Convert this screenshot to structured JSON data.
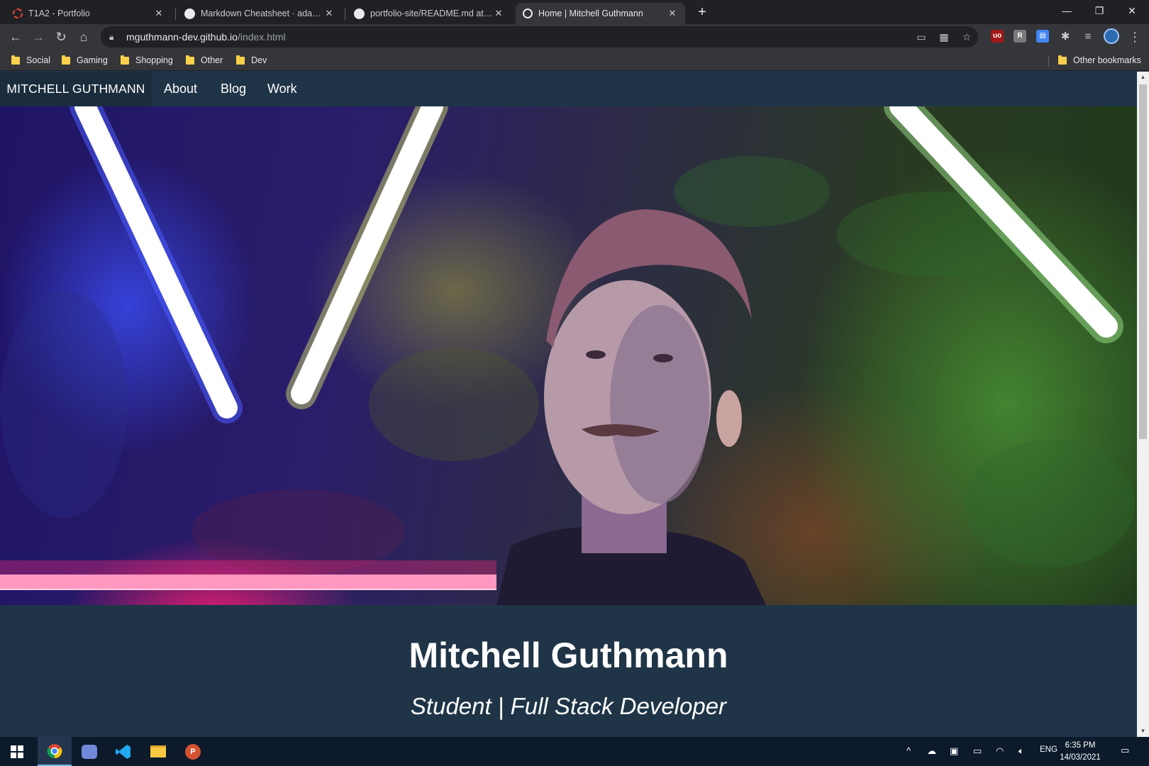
{
  "browser": {
    "tabs": [
      {
        "title": "T1A2 - Portfolio",
        "icon": "loading-spinner-icon",
        "active": false
      },
      {
        "title": "Markdown Cheatsheet · adam-p/",
        "icon": "github-icon",
        "active": false
      },
      {
        "title": "portfolio-site/README.md at ma",
        "icon": "github-icon",
        "active": false
      },
      {
        "title": "Home | Mitchell Guthmann",
        "icon": "globe-icon",
        "active": true
      }
    ],
    "address": {
      "host": "mguthmann-dev.github.io",
      "path": "/index.html"
    },
    "bookmarks": [
      "Social",
      "Gaming",
      "Shopping",
      "Other",
      "Dev"
    ],
    "other_bookmarks": "Other bookmarks"
  },
  "site": {
    "brand": "MITCHELL GUTHMANN",
    "nav": [
      "About",
      "Blog",
      "Work"
    ],
    "hero_alt": "Portrait photo with neon lights and plants",
    "heading": "Mitchell Guthmann",
    "subtitle": "Student | Full Stack Developer",
    "colors": {
      "navbar": "#1f3447",
      "brand_bg": "#1b2d3d",
      "text": "#ffffff"
    }
  },
  "taskbar": {
    "apps": [
      "start-icon",
      "chrome-icon",
      "discord-icon",
      "vscode-icon",
      "file-explorer-icon",
      "powerpoint-icon"
    ],
    "language": "ENG",
    "time": "6:35 PM",
    "date": "14/03/2021"
  }
}
